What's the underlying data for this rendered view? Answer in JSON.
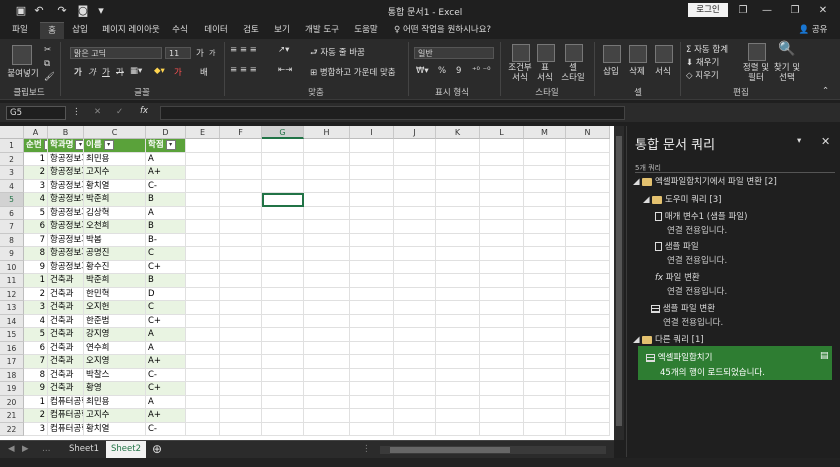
{
  "window": {
    "title": "통합 문서1  -  Excel",
    "signin": "로그인",
    "minimize": "—",
    "restore": "❐",
    "close": "✕",
    "restore_icon": "❐"
  },
  "quick_access": {
    "save": "💾",
    "undo": "↶",
    "redo": "↷",
    "camera": "📷",
    "more": "▾"
  },
  "tabs": [
    "파일",
    "홈",
    "삽입",
    "페이지 레이아웃",
    "수식",
    "데이터",
    "검토",
    "보기",
    "개발 도구",
    "도움말"
  ],
  "active_tab": "홈",
  "tell_me": "어떤 작업을 원하시나요?",
  "share": "공유",
  "ribbon": {
    "clipboard": {
      "paste": "붙여넣기",
      "group": "클립보드"
    },
    "font": {
      "name": "맑은 고딕",
      "size": "11",
      "grow": "가",
      "shrink": "가",
      "bold": "가",
      "italic": "가",
      "underline": "가",
      "strike": "가",
      "phonetic": "배",
      "group": "글꼴",
      "font_color": "가"
    },
    "alignment": {
      "wrap": "자동 줄 바꿈",
      "merge": "병합하고 가운데 맞춤",
      "group": "맞춤"
    },
    "number": {
      "format": "일반",
      "percent": "%",
      "comma": "9",
      "group": "표시 형식"
    },
    "styles": {
      "conditional": "조건부\n서식",
      "table": "표\n서식",
      "cell": "셀\n스타일",
      "group": "스타일"
    },
    "cells": {
      "insert": "삽입",
      "delete": "삭제",
      "format": "서식",
      "group": "셀"
    },
    "editing": {
      "autosum": "자동 합계",
      "fill": "채우기",
      "clear": "지우기",
      "sort": "정렬 및\n필터",
      "find": "찾기 및\n선택",
      "group": "편집"
    }
  },
  "formula_bar": {
    "name_box": "G5",
    "cancel": "✕",
    "enter": "✓",
    "fx": "fx",
    "value": ""
  },
  "columns": [
    "A",
    "B",
    "C",
    "D",
    "E",
    "F",
    "G",
    "H",
    "I",
    "J",
    "K",
    "L",
    "M",
    "N"
  ],
  "table": {
    "headers": [
      "순번",
      "학과명",
      "이름",
      "학점"
    ],
    "rows": [
      [
        "1",
        "항공정보과",
        "최민용",
        "A"
      ],
      [
        "2",
        "항공정보과",
        "고지수",
        "A+"
      ],
      [
        "3",
        "항공정보과",
        "황치열",
        "C-"
      ],
      [
        "4",
        "항공정보과",
        "박준희",
        "B"
      ],
      [
        "5",
        "항공정보과",
        "김상혁",
        "A"
      ],
      [
        "6",
        "항공정보과",
        "오천희",
        "B"
      ],
      [
        "7",
        "항공정보과",
        "박봄",
        "B-"
      ],
      [
        "8",
        "항공정보과",
        "공명진",
        "C"
      ],
      [
        "9",
        "항공정보과",
        "황수진",
        "C+"
      ],
      [
        "1",
        "건축과",
        "박준희",
        "B"
      ],
      [
        "2",
        "건축과",
        "한민혁",
        "D"
      ],
      [
        "3",
        "건축과",
        "오지헌",
        "C"
      ],
      [
        "4",
        "건축과",
        "한준범",
        "C+"
      ],
      [
        "5",
        "건축과",
        "강지영",
        "A"
      ],
      [
        "6",
        "건축과",
        "연수희",
        "A"
      ],
      [
        "7",
        "건축과",
        "오지영",
        "A+"
      ],
      [
        "8",
        "건축과",
        "박찰스",
        "C-"
      ],
      [
        "9",
        "건축과",
        "황영",
        "C+"
      ],
      [
        "1",
        "컴퓨터공학과",
        "최민용",
        "A"
      ],
      [
        "2",
        "컴퓨터공학과",
        "고지수",
        "A+"
      ],
      [
        "3",
        "컴퓨터공학과",
        "황치열",
        "C-"
      ]
    ]
  },
  "row_numbers": [
    "1",
    "2",
    "3",
    "4",
    "5",
    "6",
    "7",
    "8",
    "9",
    "10",
    "11",
    "12",
    "13",
    "14",
    "15",
    "16",
    "17",
    "18",
    "19",
    "20",
    "21",
    "22"
  ],
  "sheets": [
    "Sheet1",
    "Sheet2"
  ],
  "active_sheet": "Sheet2",
  "queries_pane": {
    "title": "통합 문서 쿼리",
    "count": "5개 쿼리",
    "group1": "엑셀파일합치기에서 파일 변환 [2]",
    "helper": "도우미 쿼리 [3]",
    "q1": {
      "name": "매개 변수1 (샘플 파일)",
      "sub": "연결 전용입니다."
    },
    "q2": {
      "name": "샘플 파일",
      "sub": "연결 전용입니다."
    },
    "q3": {
      "name": "파일 변환",
      "sub": "연결 전용입니다."
    },
    "q4": {
      "name": "샘플 파일 변환",
      "sub": "연결 전용입니다."
    },
    "group2": "다른 쿼리 [1]",
    "q5": {
      "name": "엑셀파일합치기",
      "sub": "45개의 행이 로드되었습니다."
    }
  },
  "colors": {
    "accent": "#5aa23a",
    "band": "#e9f4e2",
    "selected_query": "#2e7d32"
  }
}
